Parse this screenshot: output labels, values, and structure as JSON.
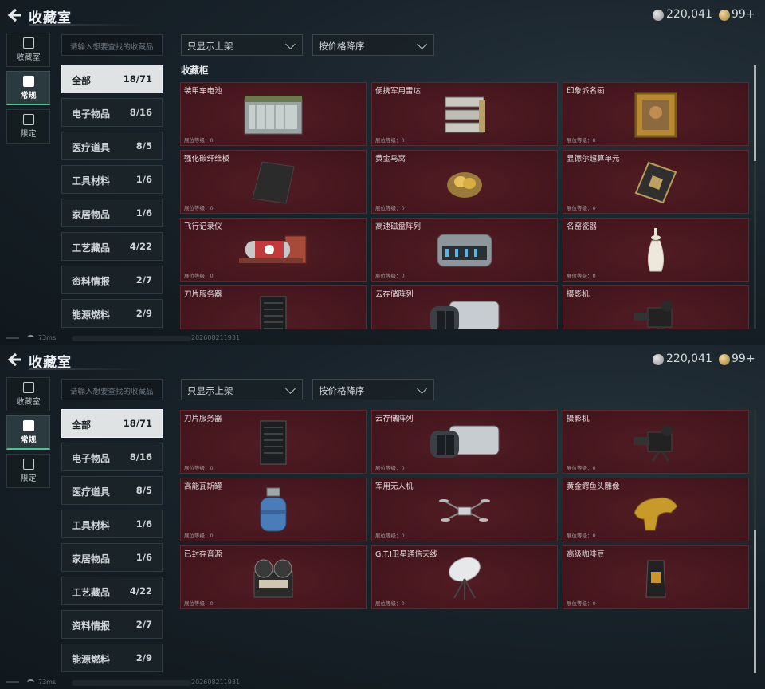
{
  "header": {
    "title": "收藏室",
    "currency_silver": "220,041",
    "currency_gold": "99+"
  },
  "sidenav": [
    {
      "label": "收藏室",
      "icon": "trophy-icon",
      "active": false
    },
    {
      "label": "常规",
      "icon": "image-icon",
      "active": true
    },
    {
      "label": "限定",
      "icon": "picture-icon",
      "active": false
    }
  ],
  "search": {
    "placeholder": "请输入想要查找的收藏品"
  },
  "filters": {
    "availability": "只显示上架",
    "sort": "按价格降序"
  },
  "categories": [
    {
      "label": "全部",
      "count": "18/71",
      "active": true
    },
    {
      "label": "电子物品",
      "count": "8/16"
    },
    {
      "label": "医疗道具",
      "count": "8/5"
    },
    {
      "label": "工具材料",
      "count": "1/6"
    },
    {
      "label": "家居物品",
      "count": "1/6"
    },
    {
      "label": "工艺藏品",
      "count": "4/22"
    },
    {
      "label": "资料情报",
      "count": "2/7"
    },
    {
      "label": "能源燃料",
      "count": "2/9"
    }
  ],
  "section_title": "收藏柜",
  "level_label": "展位等级：0",
  "items": [
    {
      "name": "装甲车电池",
      "icon": "battery-icon"
    },
    {
      "name": "便携军用雷达",
      "icon": "radar-icon"
    },
    {
      "name": "印象派名画",
      "icon": "painting-icon"
    },
    {
      "name": "强化碳纤维板",
      "icon": "carbon-plate-icon"
    },
    {
      "name": "黄金鸟窝",
      "icon": "golden-nest-icon"
    },
    {
      "name": "显德尔超算单元",
      "icon": "compute-unit-icon"
    },
    {
      "name": "飞行记录仪",
      "icon": "flight-recorder-icon"
    },
    {
      "name": "高速磁盘阵列",
      "icon": "disk-array-icon"
    },
    {
      "name": "名窑瓷器",
      "icon": "porcelain-vase-icon"
    },
    {
      "name": "刀片服务器",
      "icon": "blade-server-icon"
    },
    {
      "name": "云存储阵列",
      "icon": "cloud-storage-icon"
    },
    {
      "name": "摄影机",
      "icon": "camera-icon"
    },
    {
      "name": "高能瓦斯罐",
      "icon": "gas-tank-icon"
    },
    {
      "name": "军用无人机",
      "icon": "drone-icon"
    },
    {
      "name": "黄金鳄鱼头雕像",
      "icon": "gold-croc-statue-icon"
    },
    {
      "name": "已封存音源",
      "icon": "reel-recorder-icon"
    },
    {
      "name": "G.T.I卫星通信天线",
      "icon": "satellite-dish-icon"
    },
    {
      "name": "高级咖啡豆",
      "icon": "coffee-bag-icon"
    }
  ],
  "status": {
    "ping": "73ms",
    "stamp": "202608211931"
  },
  "colors": {
    "card_bg": "#47161d",
    "accent": "#4ec48a",
    "active_category": "#dfe3e4"
  }
}
